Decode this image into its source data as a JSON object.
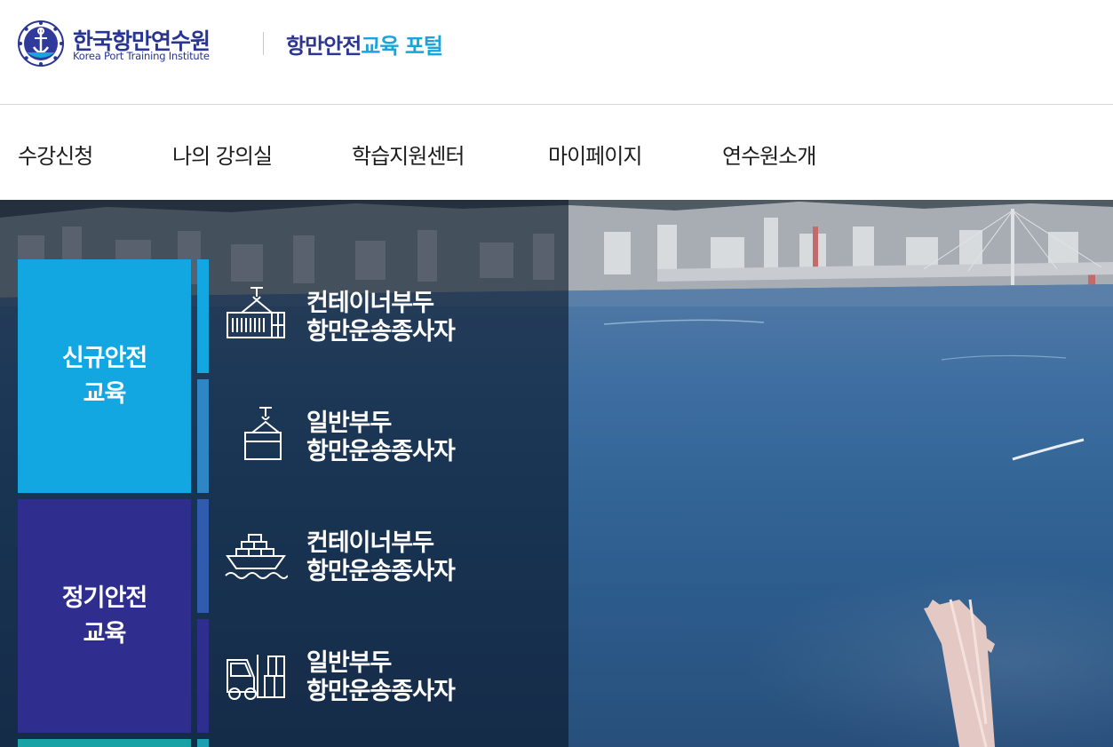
{
  "header": {
    "logo_ko": "한국항만연수원",
    "logo_en": "Korea Port Training Institute",
    "portal_main": "항만안전",
    "portal_accent": "교육 포털"
  },
  "nav": {
    "items": [
      "수강신청",
      "나의 강의실",
      "학습지원센터",
      "마이페이지",
      "연수원소개"
    ]
  },
  "hero": {
    "categories": [
      {
        "line1": "신규안전",
        "line2": "교육"
      },
      {
        "line1": "정기안전",
        "line2": "교육"
      }
    ],
    "courses": [
      {
        "icon": "container-crane-icon",
        "line1": "컨테이너부두",
        "line2": "항만운송종사자"
      },
      {
        "icon": "cargo-box-icon",
        "line1": "일반부두",
        "line2": "항만운송종사자"
      },
      {
        "icon": "container-ship-icon",
        "line1": "컨테이너부두",
        "line2": "항만운송종사자"
      },
      {
        "icon": "forklift-icon",
        "line1": "일반부두",
        "line2": "항만운송종사자"
      }
    ],
    "colors": {
      "new_category": "#13a7e1",
      "regular_category": "#2f2e8f",
      "accent_blue": "#1aa3dd",
      "brand_navy": "#283593"
    }
  }
}
